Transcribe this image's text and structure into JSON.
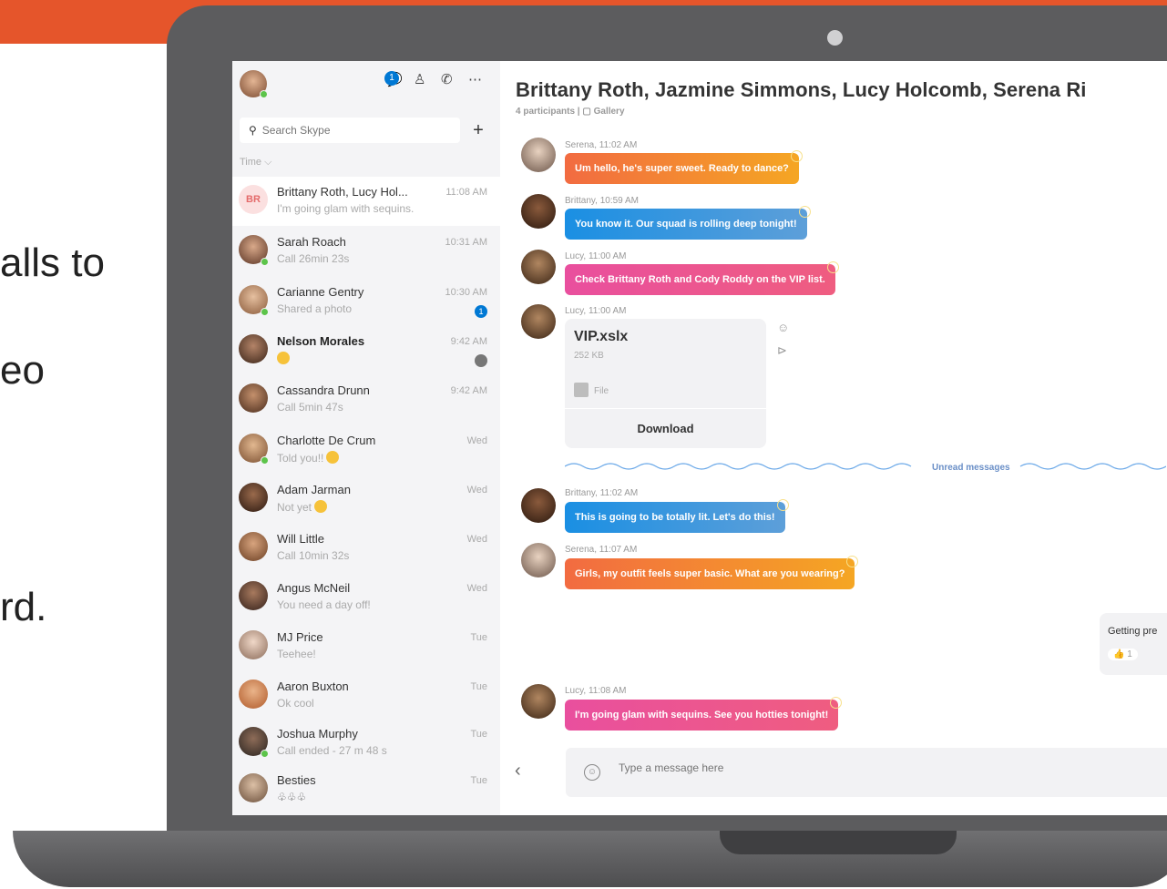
{
  "colors": {
    "accent_orange": "#e5552b",
    "skype_blue": "#0078d4",
    "presence_green": "#5cc44a"
  },
  "slide_fragments": [
    "alls to",
    "eo",
    "rd."
  ],
  "sidebar": {
    "notification_count": "1",
    "search_placeholder": "Search Skype",
    "sort_label": "Time ⌵",
    "conversations": [
      {
        "name": "Brittany Roth, Lucy Hol...",
        "initials": "BR",
        "subtitle": "I'm going glam with sequins.",
        "time": "11:08 AM"
      },
      {
        "name": "Sarah Roach",
        "subtitle": "Call 26min 23s",
        "time": "10:31 AM"
      },
      {
        "name": "Carianne Gentry",
        "subtitle": "Shared a photo",
        "time": "10:30 AM",
        "badge": "1"
      },
      {
        "name": "Nelson Morales",
        "subtitle": "",
        "time": "9:42 AM"
      },
      {
        "name": "Cassandra Drunn",
        "subtitle": "Call 5min 47s",
        "time": "9:42 AM"
      },
      {
        "name": "Charlotte De Crum",
        "subtitle": "Told you!!",
        "time": "Wed"
      },
      {
        "name": "Adam Jarman",
        "subtitle": "Not yet",
        "time": "Wed"
      },
      {
        "name": "Will Little",
        "subtitle": "Call 10min 32s",
        "time": "Wed"
      },
      {
        "name": "Angus McNeil",
        "subtitle": "You need a day off!",
        "time": "Wed"
      },
      {
        "name": "MJ Price",
        "subtitle": "Teehee!",
        "time": "Tue"
      },
      {
        "name": "Aaron Buxton",
        "subtitle": "Ok cool",
        "time": "Tue"
      },
      {
        "name": "Joshua Murphy",
        "subtitle": "Call ended - 27 m 48 s",
        "time": "Tue"
      },
      {
        "name": "Besties",
        "subtitle": "♧♧♧",
        "time": "Tue"
      }
    ]
  },
  "chat": {
    "title": "Brittany Roth, Jazmine Simmons, Lucy Holcomb, Serena Ri",
    "meta": "4 participants  |  ▢ Gallery",
    "messages": [
      {
        "meta": "Serena, 11:02 AM",
        "text": "Um hello, he's super sweet. Ready to dance?"
      },
      {
        "meta": "Brittany, 10:59 AM",
        "text": "You know it. Our squad is rolling deep tonight!"
      },
      {
        "meta": "Lucy, 11:00 AM",
        "text": "Check Brittany Roth and Cody Roddy on the VIP list."
      },
      {
        "meta": "Lucy, 11:00 AM"
      },
      {
        "meta": "Brittany, 11:02 AM",
        "text": "This is going to be totally lit. Let's do this!"
      },
      {
        "meta": "Serena, 11:07 AM",
        "text": "Girls, my outfit feels super basic. What are you wearing?"
      },
      {
        "meta": "Lucy, 11:08 AM",
        "text": "I'm going glam with sequins. See you hotties tonight!"
      }
    ],
    "file": {
      "name": "VIP.xslx",
      "size": "252 KB",
      "type": "File",
      "download_label": "Download"
    },
    "unread_label": "Unread messages",
    "peek": {
      "text": "Getting pre",
      "reaction": "👍 1"
    },
    "compose_placeholder": "Type a message here"
  }
}
